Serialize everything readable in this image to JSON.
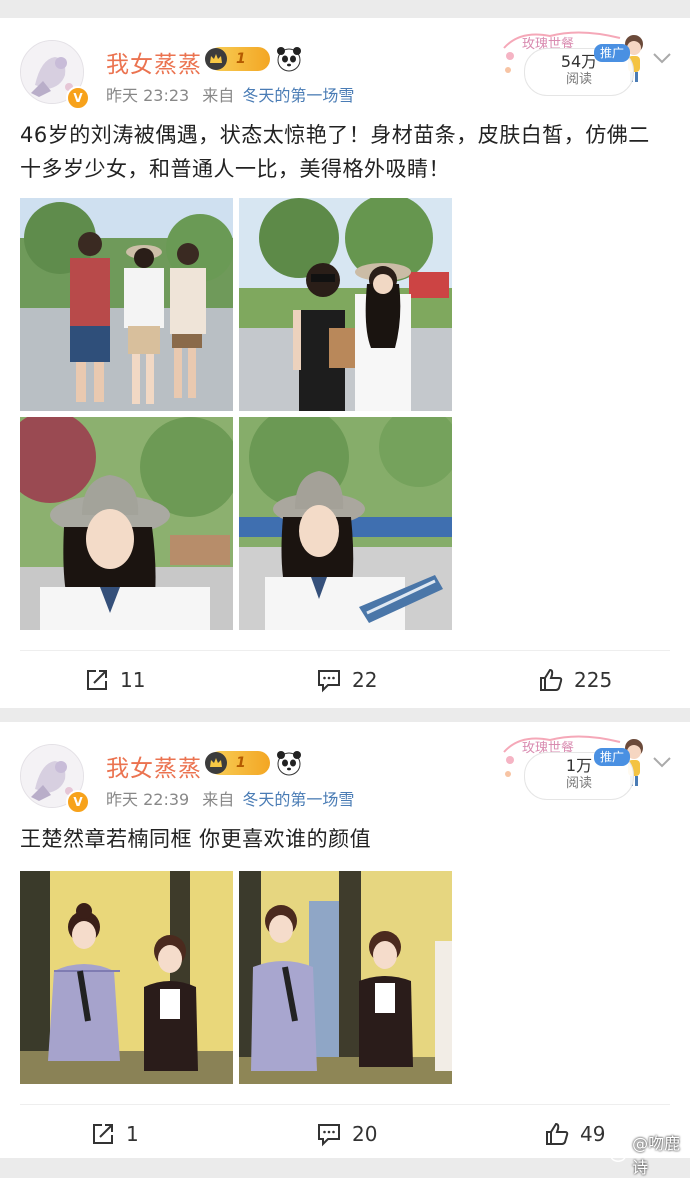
{
  "posts": [
    {
      "author": "我女蒸蒸",
      "vip_level": "1",
      "time": "昨天 23:23",
      "from_label": "来自",
      "source": "冬天的第一场雪",
      "promo_tag": "推广",
      "views": "54万",
      "views_label": "阅读",
      "text": "46岁的刘涛被偶遇，状态太惊艳了！身材苗条，皮肤白皙，仿佛二十多岁少女，和普通人一比，美得格外吸睛！",
      "reposts": "11",
      "comments": "22",
      "likes": "225"
    },
    {
      "author": "我女蒸蒸",
      "vip_level": "1",
      "time": "昨天 22:39",
      "from_label": "来自",
      "source": "冬天的第一场雪",
      "promo_tag": "推广",
      "views": "1万",
      "views_label": "阅读",
      "text": "王楚然章若楠同框 你更喜欢谁的颜值",
      "reposts": "1",
      "comments": "20",
      "likes": "49"
    }
  ],
  "promo_deco_text": "玫瑰世餐",
  "watermark": "@吻鹿诗",
  "icons": {
    "verify": "verified-badge-icon",
    "vip": "crown-icon",
    "emoji": "panda-icon",
    "repost": "repost-icon",
    "comment": "comment-icon",
    "like": "thumbs-up-icon",
    "menu": "chevron-down-icon",
    "watermark": "weibo-logo-icon"
  },
  "colors": {
    "author": "#eb7350",
    "source_link": "#4a7cb5",
    "promo_tag": "#4a90e2",
    "page_bg": "#ebebeb"
  }
}
